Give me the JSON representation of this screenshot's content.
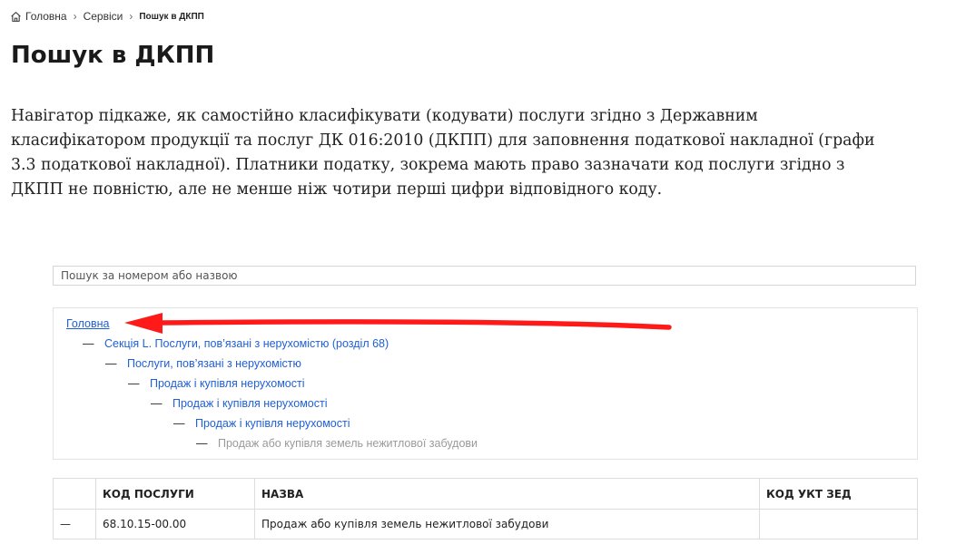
{
  "breadcrumb": {
    "home_icon": "home-icon",
    "items": [
      "Головна",
      "Сервіси",
      "Пошук в ДКПП"
    ]
  },
  "page_title": "Пошук в ДКПП",
  "intro": "Навігатор підкаже, як самостійно класифікувати (кодувати) послуги згідно з Державним класифікатором продукції та послуг ДК 016:2010 (ДКПП) для заповнення податкової накладної (графи 3.3 податкової накладної). Платники податку, зокрема мають право зазначати код послуги згідно з ДКПП не повністю, але не менше ніж чотири перші цифри відповідного коду.",
  "search": {
    "placeholder": "Пошук за номером або назвою",
    "value": ""
  },
  "tree": {
    "root": "Головна",
    "dash": "—",
    "items": [
      "Секція L. Послуги, пов’язані з нерухомістю (розділ 68)",
      "Послуги, пов’язані з нерухомістю",
      "Продаж і купівля нерухомості",
      "Продаж і купівля нерухомості",
      "Продаж і купівля нерухомості",
      "Продаж або купівля земель нежитлової забудови"
    ]
  },
  "annotation": {
    "arrow_color": "#ff1a1a"
  },
  "colors": {
    "link": "#1f5fd6",
    "muted": "#9a9a9a"
  },
  "table": {
    "headers": [
      "",
      "КОД ПОСЛУГИ",
      "НАЗВА",
      "КОД УКТ ЗЕД"
    ],
    "rows": [
      {
        "marker": "—",
        "code": "68.10.15-00.00",
        "name": "Продаж або купівля земель нежитлової забудови",
        "ukt": ""
      }
    ]
  }
}
